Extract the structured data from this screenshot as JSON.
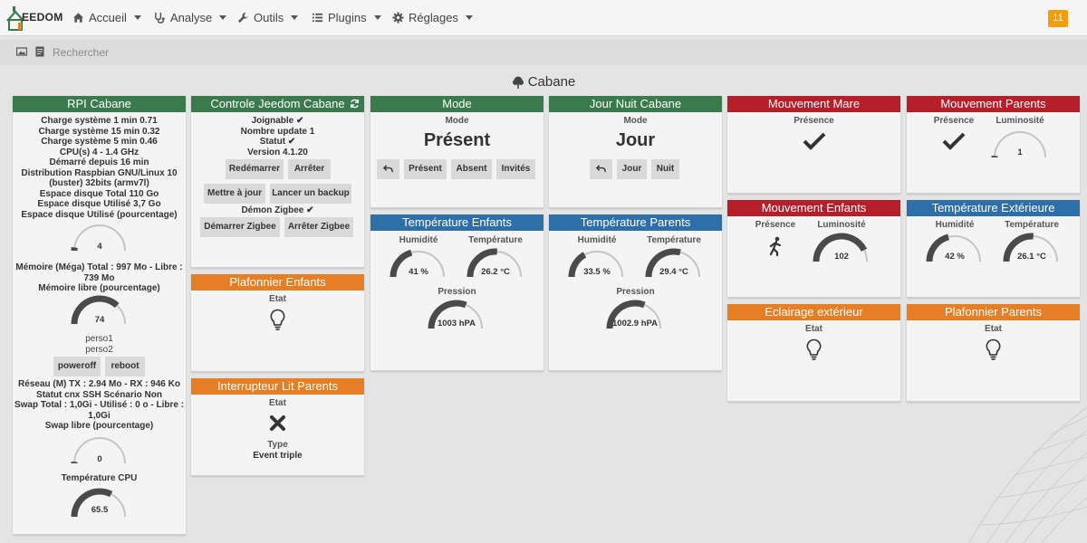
{
  "nav": {
    "brand": "EEDOM",
    "items": [
      {
        "label": "Accueil",
        "icon": "home-icon"
      },
      {
        "label": "Analyse",
        "icon": "stethoscope-icon"
      },
      {
        "label": "Outils",
        "icon": "wrench-icon"
      },
      {
        "label": "Plugins",
        "icon": "list-icon"
      },
      {
        "label": "Réglages",
        "icon": "gear-icon"
      }
    ],
    "notification_count": "11"
  },
  "search": {
    "placeholder": "Rechercher"
  },
  "room": {
    "title": "Cabane",
    "icon": "tree-icon"
  },
  "rpi": {
    "title": "RPI Cabane",
    "lines": [
      "Charge système 1 min 0.71",
      "Charge système 15 min 0.32",
      "Charge système 5 min 0.46",
      "CPU(s) 4 - 1.4 GHz",
      "Démarré depuis 16 min",
      "Distribution Raspbian GNU/Linux 10",
      "(buster) 32bits (armv7l)",
      "Espace disque Total 110 Go",
      "Espace disque Utilisé 3,7 Go",
      "Espace disque Utilisé (pourcentage)"
    ],
    "disk_pct": "4",
    "mem_lines": [
      "Mémoire (Méga) Total : 997 Mo - Libre :",
      "739 Mo",
      "Mémoire libre (pourcentage)"
    ],
    "mem_pct": "74",
    "perso": [
      "perso1",
      "perso2"
    ],
    "poweroff": "poweroff",
    "reboot": "reboot",
    "net_lines": [
      "Réseau (M) TX : 2.94 Mo - RX : 946 Ko",
      "Statut cnx SSH Scénario Non",
      "Swap Total : 1,0Gi - Utilisé : 0 o - Libre :",
      "1,0Gi",
      "Swap libre (pourcentage)"
    ],
    "swap_pct": "0",
    "cpu_temp_label": "Température CPU",
    "cpu_temp": "65.5"
  },
  "controle": {
    "title": "Controle Jeedom Cabane",
    "joignable": "Joignable",
    "nombre_update": "Nombre update 1",
    "statut": "Statut",
    "version": "Version 4.1.20",
    "btn_redemarrer": "Redémarrer",
    "btn_arreter": "Arrêter",
    "btn_maj": "Mettre à jour",
    "btn_backup": "Lancer un backup",
    "demon": "Démon Zigbee",
    "btn_demarrer_zigbee": "Démarrer Zigbee",
    "btn_arreter_zigbee": "Arrêter Zigbee"
  },
  "plafonnier_enfants": {
    "title": "Plafonnier Enfants",
    "etat": "Etat"
  },
  "interrupteur": {
    "title": "Interrupteur Lit Parents",
    "etat": "Etat",
    "type_label": "Type",
    "type_value": "Event triple"
  },
  "mode": {
    "title": "Mode",
    "label": "Mode",
    "value": "Présent",
    "btn_present": "Présent",
    "btn_absent": "Absent",
    "btn_invites": "Invités"
  },
  "jour_nuit": {
    "title": "Jour Nuit Cabane",
    "label": "Mode",
    "value": "Jour",
    "btn_jour": "Jour",
    "btn_nuit": "Nuit"
  },
  "temp_enfants": {
    "title": "Température Enfants",
    "humidite_label": "Humidité",
    "humidite": "41 %",
    "temp_label": "Température",
    "temp": "26.2 °C",
    "pression_label": "Pression",
    "pression": "1003 hPA",
    "humidite_frac": 0.41,
    "temp_frac": 0.52,
    "pression_frac": 0.62
  },
  "temp_parents": {
    "title": "Température Parents",
    "humidite_label": "Humidité",
    "humidite": "33.5 %",
    "temp_label": "Température",
    "temp": "29.4 °C",
    "pression_label": "Pression",
    "pression": "1002.9 hPA",
    "humidite_frac": 0.34,
    "temp_frac": 0.58,
    "pression_frac": 0.62
  },
  "mouvement_mare": {
    "title": "Mouvement Mare",
    "presence": "Présence"
  },
  "mouvement_parents": {
    "title": "Mouvement Parents",
    "presence": "Présence",
    "luminosite_label": "Luminosité",
    "luminosite": "1",
    "luminosite_frac": 0.01
  },
  "mouvement_enfants": {
    "title": "Mouvement Enfants",
    "presence": "Présence",
    "luminosite_label": "Luminosité",
    "luminosite": "102",
    "luminosite_frac": 0.85
  },
  "temp_exterieure": {
    "title": "Température Extérieure",
    "humidite_label": "Humidité",
    "humidite": "42 %",
    "temp_label": "Température",
    "temp": "26.1 °C",
    "humidite_frac": 0.42,
    "temp_frac": 0.52
  },
  "eclairage": {
    "title": "Eclairage extérieur",
    "etat": "Etat"
  },
  "plafonnier_parents": {
    "title": "Plafonnier Parents",
    "etat": "Etat"
  },
  "gauges": {
    "disk_frac": 0.04,
    "mem_frac": 0.74,
    "swap_frac": 0.0,
    "cpu_frac": 0.65
  }
}
